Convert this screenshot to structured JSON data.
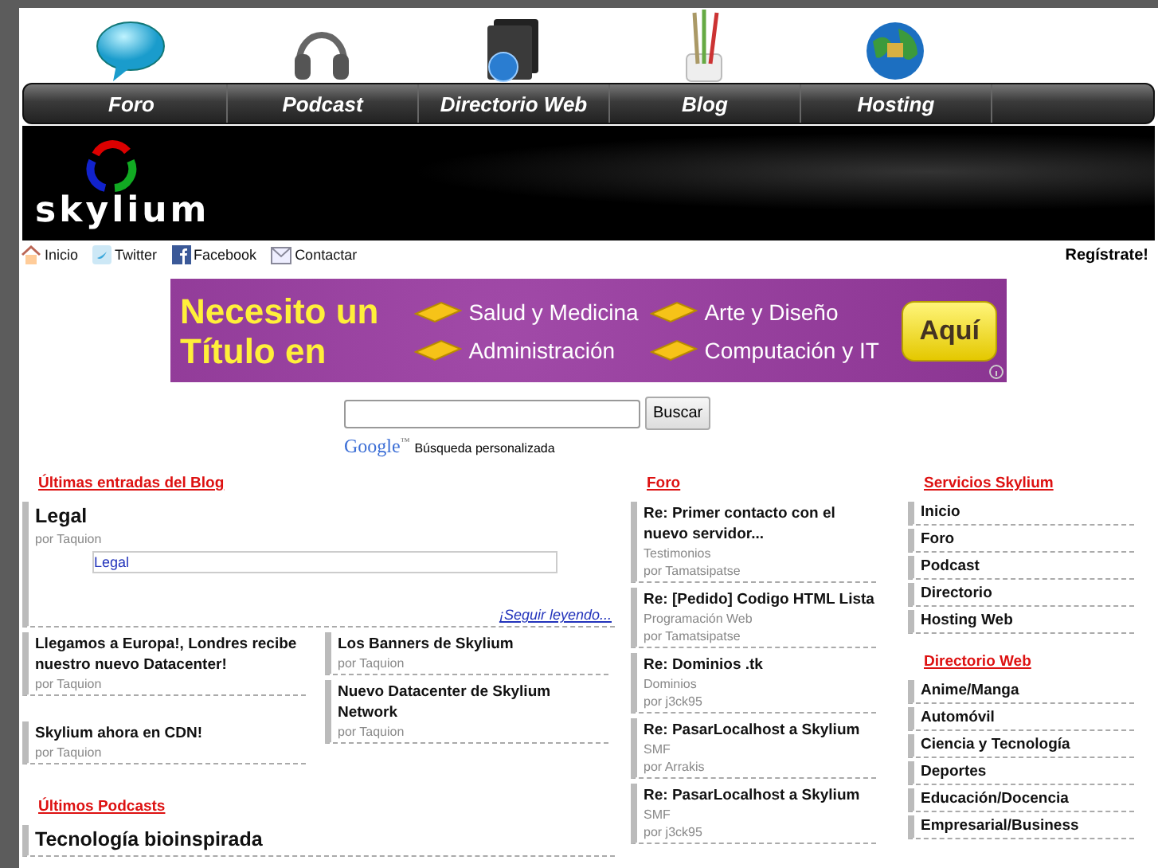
{
  "nav": [
    {
      "label": "Foro"
    },
    {
      "label": "Podcast"
    },
    {
      "label": "Directorio Web"
    },
    {
      "label": "Blog"
    },
    {
      "label": "Hosting"
    }
  ],
  "logo": {
    "text": "skylium"
  },
  "top_links": [
    {
      "label": "Inicio"
    },
    {
      "label": "Twitter"
    },
    {
      "label": "Facebook"
    },
    {
      "label": "Contactar"
    }
  ],
  "register": "Regístrate!",
  "ad": {
    "headline_1": "Necesito un",
    "headline_2": "Título en",
    "options": [
      "Salud y Medicina",
      "Arte y Diseño",
      "Administración",
      "Computación y IT"
    ],
    "button": "Aquí"
  },
  "search": {
    "button": "Buscar",
    "brand": "Google",
    "brand_mark": "™",
    "caption": "Búsqueda personalizada"
  },
  "blog": {
    "heading": "Últimas entradas del Blog",
    "featured": {
      "title": "Legal",
      "author": "por Taquion",
      "link": "Legal",
      "more": "¡Seguir leyendo..."
    },
    "posts": [
      {
        "title": "Llegamos a Europa!, Londres recibe nuestro nuevo Datacenter!",
        "author": "por Taquion"
      },
      {
        "title": "Skylium ahora en CDN!",
        "author": "por Taquion"
      },
      {
        "title": "Los Banners de Skylium",
        "author": "por Taquion"
      },
      {
        "title": "Nuevo Datacenter de Skylium Network",
        "author": "por Taquion"
      }
    ]
  },
  "podcasts": {
    "heading": "Últimos Podcasts",
    "items": [
      {
        "title": "Tecnología bioinspirada"
      }
    ]
  },
  "forum": {
    "heading": "Foro",
    "items": [
      {
        "title": "Re: Primer contacto con el nuevo servidor...",
        "category": "Testimonios",
        "author": "por Tamatsipatse"
      },
      {
        "title": "Re: [Pedido] Codigo HTML Lista",
        "category": "Programación Web",
        "author": "por Tamatsipatse"
      },
      {
        "title": "Re: Dominios .tk",
        "category": "Dominios",
        "author": "por j3ck95"
      },
      {
        "title": "Re: PasarLocalhost a Skylium",
        "category": "SMF",
        "author": "por Arrakis"
      },
      {
        "title": "Re: PasarLocalhost a Skylium",
        "category": "SMF",
        "author": "por j3ck95"
      }
    ]
  },
  "services": {
    "heading": "Servicios Skylium",
    "items": [
      "Inicio",
      "Foro",
      "Podcast",
      "Directorio",
      "Hosting Web"
    ]
  },
  "directory": {
    "heading": "Directorio Web",
    "items": [
      "Anime/Manga",
      "Automóvil",
      "Ciencia y Tecnología",
      "Deportes",
      "Educación/Docencia",
      "Empresarial/Business"
    ]
  }
}
